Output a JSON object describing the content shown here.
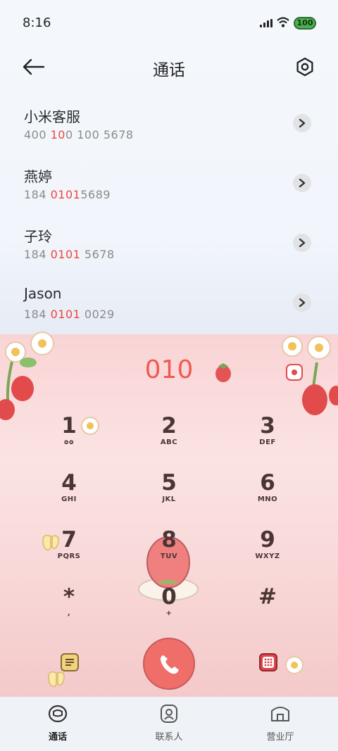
{
  "status_bar": {
    "time": "8:16",
    "battery": "100"
  },
  "header": {
    "title": "通话"
  },
  "contacts": [
    {
      "name": "小米客服",
      "number_parts": [
        "400 ",
        "10",
        "0 100 5678"
      ]
    },
    {
      "name": "燕婷",
      "number_parts": [
        "184 ",
        "0101",
        "5689"
      ]
    },
    {
      "name": "子玲",
      "number_parts": [
        "184 ",
        "0101",
        " 5678"
      ]
    },
    {
      "name": "Jason",
      "number_parts": [
        "184 ",
        "0101",
        " 0029"
      ]
    }
  ],
  "dialed": "010",
  "keypad": [
    {
      "digit": "1",
      "letters": "ᴑᴑ"
    },
    {
      "digit": "2",
      "letters": "ABC"
    },
    {
      "digit": "3",
      "letters": "DEF"
    },
    {
      "digit": "4",
      "letters": "GHI"
    },
    {
      "digit": "5",
      "letters": "JKL"
    },
    {
      "digit": "6",
      "letters": "MNO"
    },
    {
      "digit": "7",
      "letters": "PQRS"
    },
    {
      "digit": "8",
      "letters": "TUV"
    },
    {
      "digit": "9",
      "letters": "WXYZ"
    },
    {
      "digit": "*",
      "letters": ","
    },
    {
      "digit": "0",
      "letters": "+"
    },
    {
      "digit": "#",
      "letters": ""
    }
  ],
  "bottom_nav": [
    {
      "label": "通话",
      "icon": "phone-icon",
      "active": true
    },
    {
      "label": "联系人",
      "icon": "contacts-icon",
      "active": false
    },
    {
      "label": "营业厅",
      "icon": "store-icon",
      "active": false
    }
  ],
  "colors": {
    "accent": "#f05a52",
    "pad_bg": "#f9d4d5",
    "call_button": "#f06e6a"
  }
}
